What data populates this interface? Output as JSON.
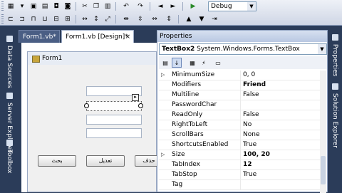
{
  "toolbar": {
    "config_value": "Debug",
    "icons": [
      "new-project-icon",
      "add-item-icon",
      "open-icon",
      "save-icon",
      "save-all-icon",
      "cut-icon",
      "copy-icon",
      "paste-icon",
      "undo-icon",
      "redo-icon",
      "navigate-back-icon",
      "navigate-forward-icon",
      "start-icon"
    ]
  },
  "left_panel": {
    "tabs": [
      {
        "label": "Data Sources"
      },
      {
        "label": "Server Explorer"
      },
      {
        "label": "Toolbox"
      }
    ]
  },
  "doc_tabs": [
    {
      "label": "Form1.vb*"
    },
    {
      "label": "Form1.vb [Design]*",
      "close": "×"
    }
  ],
  "form": {
    "title": "Form1",
    "smart_tag": "▸",
    "buttons": [
      {
        "label": "بحث"
      },
      {
        "label": "تعديل"
      },
      {
        "label": "حذف"
      }
    ]
  },
  "properties": {
    "title": "Properties",
    "object_name": "TextBox2",
    "object_type": "System.Windows.Forms.TextBox",
    "rows": [
      {
        "expand": "▷",
        "name": "MinimumSize",
        "value": "0, 0",
        "bold": false
      },
      {
        "expand": "",
        "name": "Modifiers",
        "value": "Friend",
        "bold": true
      },
      {
        "expand": "",
        "name": "Multiline",
        "value": "False",
        "bold": false
      },
      {
        "expand": "",
        "name": "PasswordChar",
        "value": "",
        "bold": false
      },
      {
        "expand": "",
        "name": "ReadOnly",
        "value": "False",
        "bold": false
      },
      {
        "expand": "",
        "name": "RightToLeft",
        "value": "No",
        "bold": false
      },
      {
        "expand": "",
        "name": "ScrollBars",
        "value": "None",
        "bold": false
      },
      {
        "expand": "",
        "name": "ShortcutsEnabled",
        "value": "True",
        "bold": false
      },
      {
        "expand": "▷",
        "name": "Size",
        "value": "100, 20",
        "bold": true
      },
      {
        "expand": "",
        "name": "TabIndex",
        "value": "12",
        "bold": true
      },
      {
        "expand": "",
        "name": "TabStop",
        "value": "True",
        "bold": false
      },
      {
        "expand": "",
        "name": "Tag",
        "value": "",
        "bold": false
      }
    ]
  },
  "right_panel": {
    "tabs": [
      {
        "label": "Properties"
      },
      {
        "label": "Solution Explorer"
      }
    ]
  }
}
